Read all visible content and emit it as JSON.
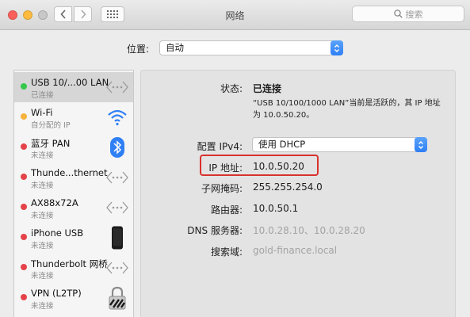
{
  "window": {
    "title": "网络"
  },
  "search": {
    "placeholder": "搜索"
  },
  "location": {
    "label": "位置:",
    "value": "自动"
  },
  "services": [
    {
      "name": "USB 10/...00 LAN",
      "status": "已连接",
      "status_color": "#34c84a",
      "icon": "ethernet-icon",
      "selected": true
    },
    {
      "name": "Wi-Fi",
      "status": "自分配的 IP",
      "status_color": "#f5b33c",
      "icon": "wifi-icon"
    },
    {
      "name": "蓝牙 PAN",
      "status": "未连接",
      "status_color": "#e5434a",
      "icon": "bluetooth-icon"
    },
    {
      "name": "Thunde...thernet",
      "status": "未连接",
      "status_color": "#e5434a",
      "icon": "ethernet-icon"
    },
    {
      "name": "AX88x72A",
      "status": "未连接",
      "status_color": "#e5434a",
      "icon": "ethernet-icon"
    },
    {
      "name": "iPhone USB",
      "status": "未连接",
      "status_color": "#e5434a",
      "icon": "iphone-icon"
    },
    {
      "name": "Thunderbolt 网桥",
      "status": "未连接",
      "status_color": "#e5434a",
      "icon": "ethernet-icon"
    },
    {
      "name": "VPN (L2TP)",
      "status": "未连接",
      "status_color": "#e5434a",
      "icon": "vpn-lock-icon"
    }
  ],
  "detail": {
    "status_label": "状态:",
    "status_value": "已连接",
    "status_desc": "“USB 10/100/1000 LAN”当前是活跃的，其 IP 地址为 10.0.50.20。",
    "ipv4_label": "配置 IPv4:",
    "ipv4_value": "使用 DHCP",
    "ip_label": "IP 地址:",
    "ip_value": "10.0.50.20",
    "subnet_label": "子网掩码:",
    "subnet_value": "255.255.254.0",
    "router_label": "路由器:",
    "router_value": "10.0.50.1",
    "dns_label": "DNS 服务器:",
    "dns_value": "10.0.28.10、10.0.28.20",
    "search_domain_label": "搜索域:",
    "search_domain_value": "gold-finance.local"
  },
  "colors": {
    "highlight": "#d8322d",
    "accent": "#2f7ff5"
  }
}
